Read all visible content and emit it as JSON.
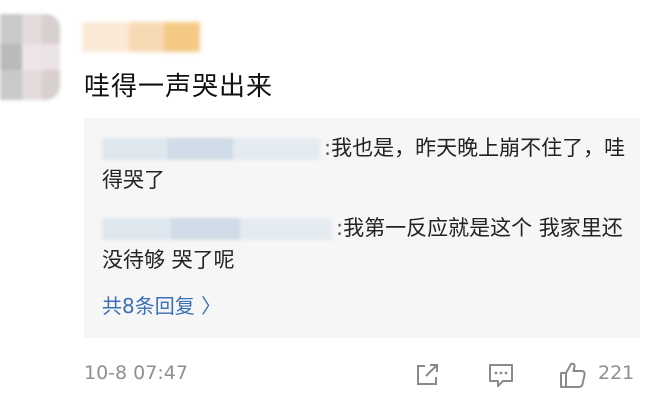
{
  "comment": {
    "text": "哇得一声哭出来"
  },
  "replies": [
    {
      "separator": ":",
      "text": "我也是，昨天晚上崩不住了，哇得哭了"
    },
    {
      "separator": ":",
      "text": "我第一反应就是这个  我家里还没待够 哭了呢"
    }
  ],
  "more_replies_label": "共8条回复 〉",
  "footer": {
    "timestamp": "10-8 07:47",
    "like_count": "221"
  },
  "icons": {
    "share": "share-icon",
    "comment": "comment-icon",
    "like": "thumbs-up-icon"
  }
}
